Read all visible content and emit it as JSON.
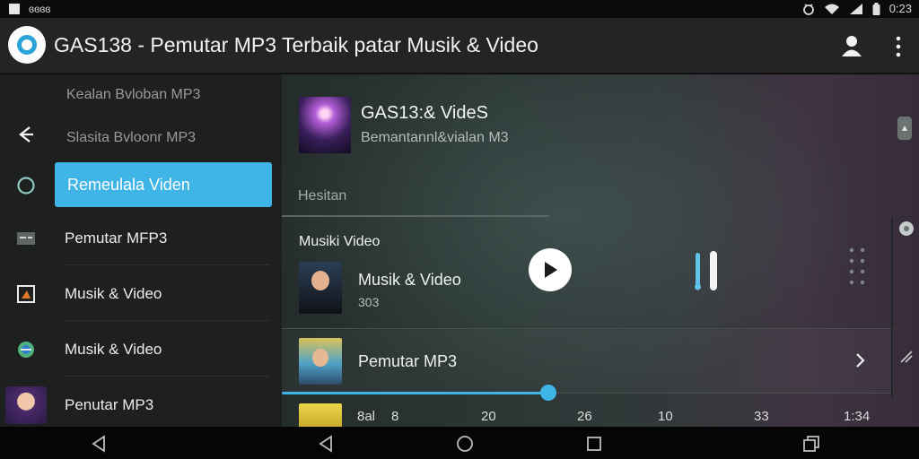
{
  "status_bar": {
    "left_text": "ɞɞɞɞ",
    "time": "0:23",
    "icons": [
      "app-notification-icon",
      "alarm-icon",
      "wifi-icon",
      "signal-icon",
      "battery-icon"
    ]
  },
  "app_bar": {
    "title": "GAS138 - Pemutar MP3 Terbaik patar Musik & Video",
    "icons": [
      "app-logo-icon",
      "account-icon",
      "more-vert-icon"
    ]
  },
  "sidebar": {
    "top_items": [
      "Kealan Bvloban MP3",
      "Slasita Bvloonr MP3"
    ],
    "active_item": "Remeulala Viden",
    "items": [
      {
        "label": "Pemutar MFP3",
        "icon": "list-icon"
      },
      {
        "label": "Musik & Video",
        "icon": "image-icon"
      },
      {
        "label": "Musik & Video",
        "icon": "browser-icon"
      },
      {
        "label": "Penutar MP3",
        "icon": "thumbnail"
      }
    ]
  },
  "now_playing": {
    "title": "GAS13:& VideS",
    "subtitle": "Bemantannl&vialan M3"
  },
  "section_label": "Hesitan",
  "sub_section": "Musiki Video",
  "tracks": [
    {
      "title": "Musik & Video",
      "meta": "303"
    },
    {
      "title": "Pemutar MP3",
      "meta": ""
    }
  ],
  "progress": 0.43,
  "timeline_labels": [
    "8al",
    "8",
    "20",
    "26",
    "10",
    "33",
    "1:34"
  ],
  "colors": {
    "accent": "#3fb4e6",
    "app_bar": "#242424",
    "sidebar": "#1e1f1f",
    "status_bar": "#0b0b0b"
  },
  "nav_bar": {
    "icons": [
      "back-icon",
      "back-icon",
      "home-icon",
      "recents-icon",
      "overview-icon"
    ]
  }
}
